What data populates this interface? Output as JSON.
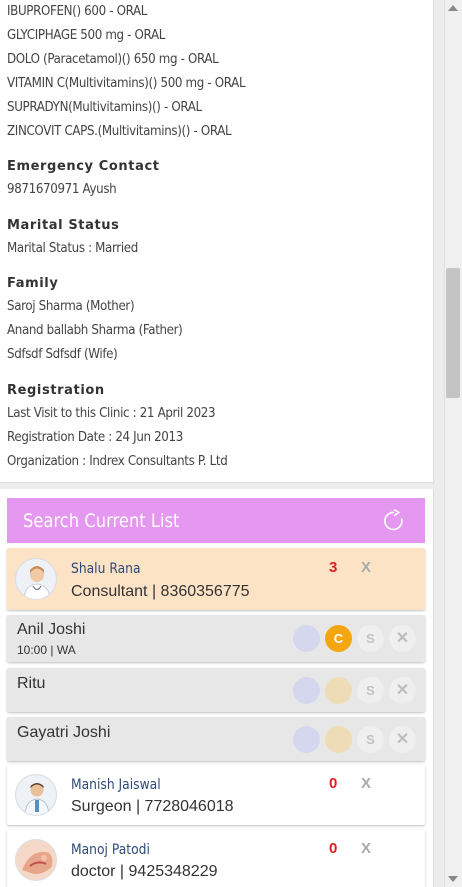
{
  "profile": {
    "medications": [
      "IBUPROFEN() 600 - ORAL",
      "GLYCIPHAGE 500 mg - ORAL",
      "DOLO (Paracetamol)() 650 mg - ORAL",
      "VITAMIN C(Multivitamins)() 500 mg - ORAL",
      "SUPRADYN(Multivitamins)() - ORAL",
      "ZINCOVIT CAPS.(Multivitamins)() - ORAL"
    ],
    "emergency": {
      "heading": "Emergency Contact",
      "value": "9871670971 Ayush"
    },
    "marital": {
      "heading": "Marital Status",
      "value": "Marital Status : Married"
    },
    "family": {
      "heading": "Family",
      "members": [
        "Saroj Sharma (Mother)",
        "Anand ballabh Sharma (Father)",
        "Sdfsdf Sdfsdf (Wife)"
      ]
    },
    "registration": {
      "heading": "Registration",
      "lines": [
        "Last Visit to this Clinic : 21 April 2023",
        "Registration Date : 24 Jun 2013",
        "Organization : Indrex Consultants P. Ltd"
      ]
    }
  },
  "list": {
    "search_label": "Search Current List",
    "icons": {
      "refresh": "refresh-icon",
      "avatar": "doctor-avatar"
    },
    "colors": {
      "header": "#e598ef",
      "current_row": "#fde3c6",
      "count": "#e02020",
      "consult_active": "#f4a60e"
    },
    "doctors": [
      {
        "name": "Shalu Rana",
        "role": "Consultant | 8360356775",
        "count": "3",
        "close": "X"
      },
      {
        "name": "Manish Jaiswal",
        "role": "Surgeon | 7728046018",
        "count": "0",
        "close": "X"
      },
      {
        "name": "Manoj Patodi",
        "role": "doctor | 9425348229",
        "count": "0",
        "close": "X"
      }
    ],
    "patients": [
      {
        "name": "Anil Joshi",
        "meta": "10:00 | WA",
        "c": "C",
        "s": "S",
        "x": "✕",
        "active": true
      },
      {
        "name": "Ritu",
        "meta": "",
        "c": "",
        "s": "S",
        "x": "✕",
        "active": false
      },
      {
        "name": "Gayatri Joshi",
        "meta": "",
        "c": "",
        "s": "S",
        "x": "✕",
        "active": false
      }
    ]
  }
}
